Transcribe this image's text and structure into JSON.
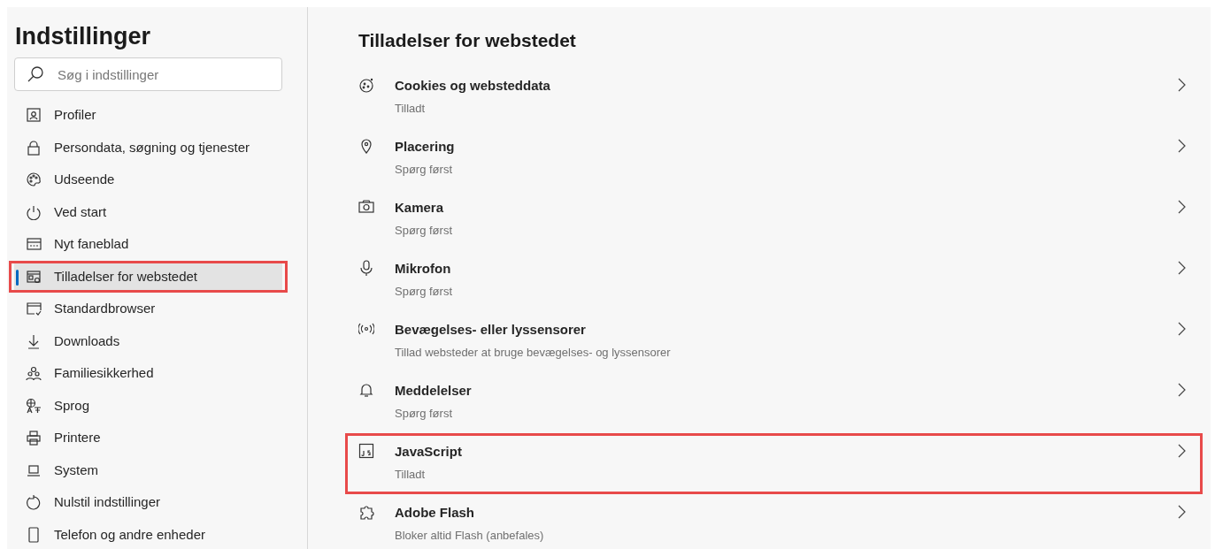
{
  "sidebar": {
    "title": "Indstillinger",
    "search": {
      "placeholder": "Søg i indstillinger"
    },
    "items": [
      {
        "label": "Profiler",
        "selected": false,
        "highlighted": false
      },
      {
        "label": "Persondata, søgning og tjenester",
        "selected": false,
        "highlighted": false
      },
      {
        "label": "Udseende",
        "selected": false,
        "highlighted": false
      },
      {
        "label": "Ved start",
        "selected": false,
        "highlighted": false
      },
      {
        "label": "Nyt faneblad",
        "selected": false,
        "highlighted": false
      },
      {
        "label": "Tilladelser for webstedet",
        "selected": true,
        "highlighted": true
      },
      {
        "label": "Standardbrowser",
        "selected": false,
        "highlighted": false
      },
      {
        "label": "Downloads",
        "selected": false,
        "highlighted": false
      },
      {
        "label": "Familiesikkerhed",
        "selected": false,
        "highlighted": false
      },
      {
        "label": "Sprog",
        "selected": false,
        "highlighted": false
      },
      {
        "label": "Printere",
        "selected": false,
        "highlighted": false
      },
      {
        "label": "System",
        "selected": false,
        "highlighted": false
      },
      {
        "label": "Nulstil indstillinger",
        "selected": false,
        "highlighted": false
      },
      {
        "label": "Telefon og andre enheder",
        "selected": false,
        "highlighted": false
      }
    ]
  },
  "main": {
    "title": "Tilladelser for webstedet",
    "permissions": [
      {
        "name": "Cookies og websteddata",
        "status": "Tilladt",
        "highlighted": false
      },
      {
        "name": "Placering",
        "status": "Spørg først",
        "highlighted": false
      },
      {
        "name": "Kamera",
        "status": "Spørg først",
        "highlighted": false
      },
      {
        "name": "Mikrofon",
        "status": "Spørg først",
        "highlighted": false
      },
      {
        "name": "Bevægelses- eller lyssensorer",
        "status": "Tillad websteder at bruge bevægelses- og lyssensorer",
        "highlighted": false
      },
      {
        "name": "Meddelelser",
        "status": "Spørg først",
        "highlighted": false
      },
      {
        "name": "JavaScript",
        "status": "Tilladt",
        "highlighted": true
      },
      {
        "name": "Adobe Flash",
        "status": "Bloker altid Flash (anbefales)",
        "highlighted": false
      }
    ]
  }
}
